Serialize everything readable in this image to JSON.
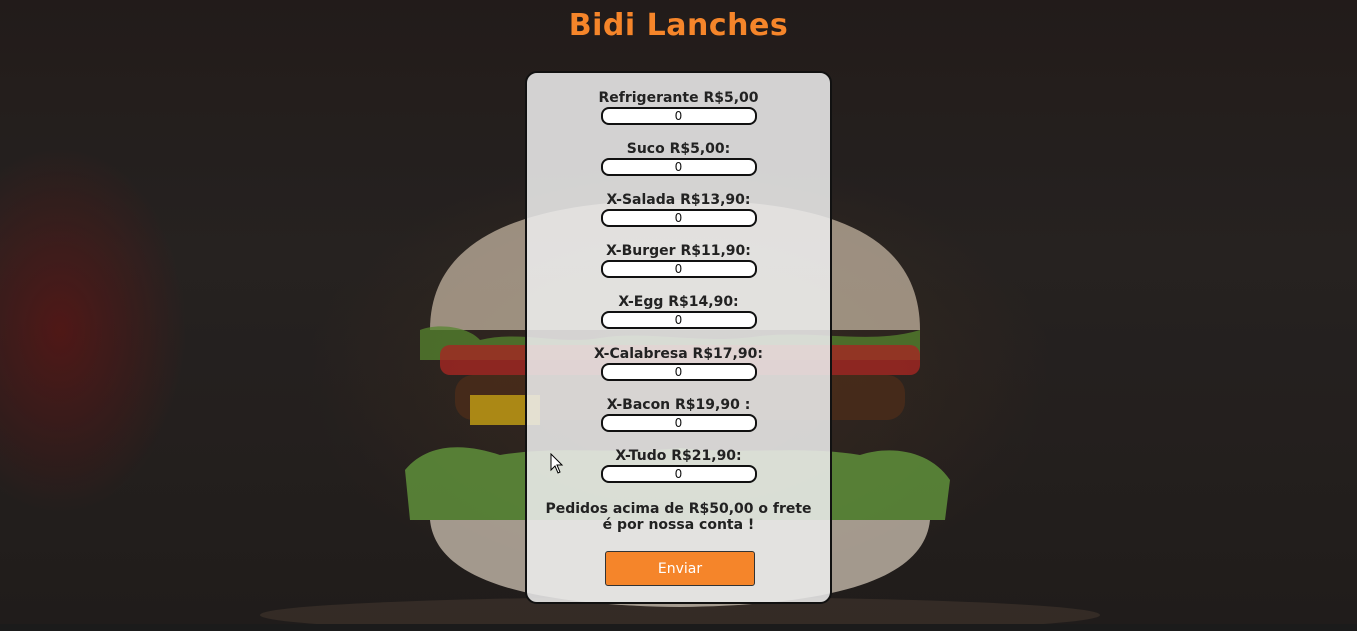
{
  "page": {
    "title": "Bidi Lanches"
  },
  "form": {
    "items": [
      {
        "label": "Refrigerante R$5,00",
        "value": "0"
      },
      {
        "label": "Suco R$5,00:",
        "value": "0"
      },
      {
        "label": "X-Salada R$13,90:",
        "value": "0"
      },
      {
        "label": "X-Burger R$11,90:",
        "value": "0"
      },
      {
        "label": "X-Egg R$14,90:",
        "value": "0"
      },
      {
        "label": "X-Calabresa R$17,90:",
        "value": "0"
      },
      {
        "label": "X-Bacon R$19,90 :",
        "value": "0"
      },
      {
        "label": "X-Tudo R$21,90:",
        "value": "0"
      }
    ],
    "shipping_note": "Pedidos acima de R$50,00 o frete é por nossa conta !",
    "submit_label": "Enviar"
  },
  "colors": {
    "accent": "#f5852a",
    "card_background": "#ececec",
    "page_background": "#2a2422"
  }
}
